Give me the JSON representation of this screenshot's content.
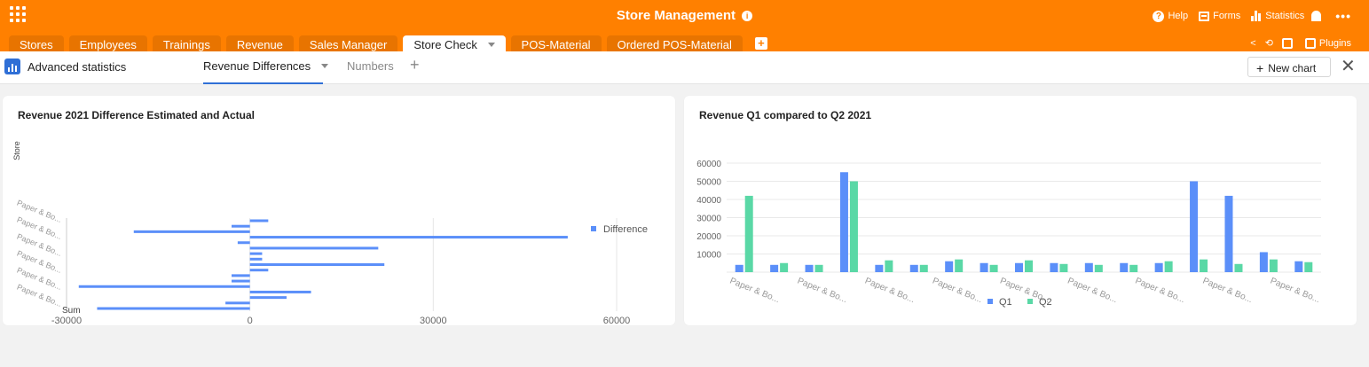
{
  "app": {
    "title": "Store Management",
    "accent_color": "#ff8000",
    "icons": {
      "apps": "grid-icon",
      "info": "info-icon"
    },
    "actions": [
      {
        "label": "Help",
        "icon": "help-icon"
      },
      {
        "label": "Forms",
        "icon": "forms-icon"
      },
      {
        "label": "Statistics",
        "icon": "statistics-icon"
      }
    ],
    "bell_icon": "bell-icon",
    "more_glyph": "•••"
  },
  "tabs": [
    {
      "label": "Stores",
      "active": false
    },
    {
      "label": "Employees",
      "active": false
    },
    {
      "label": "Trainings",
      "active": false
    },
    {
      "label": "Revenue",
      "active": false
    },
    {
      "label": "Sales Manager",
      "active": false
    },
    {
      "label": "Store Check",
      "active": true
    },
    {
      "label": "POS-Material",
      "active": false
    },
    {
      "label": "Ordered POS-Material",
      "active": false
    }
  ],
  "tab_tools": {
    "plugins_label": "Plugins"
  },
  "statistics": {
    "title": "Advanced statistics",
    "tabs": [
      {
        "label": "Revenue Differences",
        "active": true
      },
      {
        "label": "Numbers",
        "active": false
      }
    ],
    "new_chart_label": "New chart",
    "close_glyph": "✕"
  },
  "chart_data": [
    {
      "type": "bar",
      "orientation": "horizontal",
      "title": "Revenue 2021 Difference Estimated and Actual",
      "xlabel": "Sum",
      "ylabel": "Store",
      "xlim": [
        -30000,
        60000
      ],
      "xticks": [
        "-30000",
        "0",
        "30000",
        "60000"
      ],
      "category_labels": [
        "Paper & Bo...",
        "Paper & Bo...",
        "Paper & Bo...",
        "Paper & Bo...",
        "Paper & Bo...",
        "Paper & Bo..."
      ],
      "series": [
        {
          "name": "Difference",
          "color": "#5b8ff9",
          "values": [
            3000,
            -3000,
            -19000,
            52000,
            -2000,
            21000,
            2000,
            2000,
            22000,
            3000,
            -3000,
            -3000,
            -28000,
            10000,
            6000,
            -4000,
            -25000
          ]
        }
      ],
      "grid": true,
      "legend": "right"
    },
    {
      "type": "bar",
      "title": "Revenue Q1 compared to Q2 2021",
      "ylim": [
        0,
        60000
      ],
      "y_tick_count": 7,
      "category_labels": [
        "Paper & Bo...",
        "Paper & Bo...",
        "Paper & Bo...",
        "Paper & Bo...",
        "Paper & Bo...",
        "Paper & Bo...",
        "Paper & Bo...",
        "Paper & Bo...",
        "Paper & Bo..."
      ],
      "series": [
        {
          "name": "Q1",
          "color": "#5b8ff9",
          "values": [
            4000,
            4000,
            4000,
            55000,
            4000,
            4000,
            6000,
            5000,
            5000,
            5000,
            5000,
            5000,
            5000,
            50000,
            42000,
            11000,
            6000
          ]
        },
        {
          "name": "Q2",
          "color": "#5ad8a6",
          "values": [
            42000,
            5000,
            4000,
            50000,
            6500,
            4000,
            7000,
            4000,
            6500,
            4500,
            4000,
            4000,
            6000,
            7000,
            4500,
            7000,
            5500
          ]
        }
      ],
      "grid": true,
      "legend": "bottom"
    }
  ]
}
